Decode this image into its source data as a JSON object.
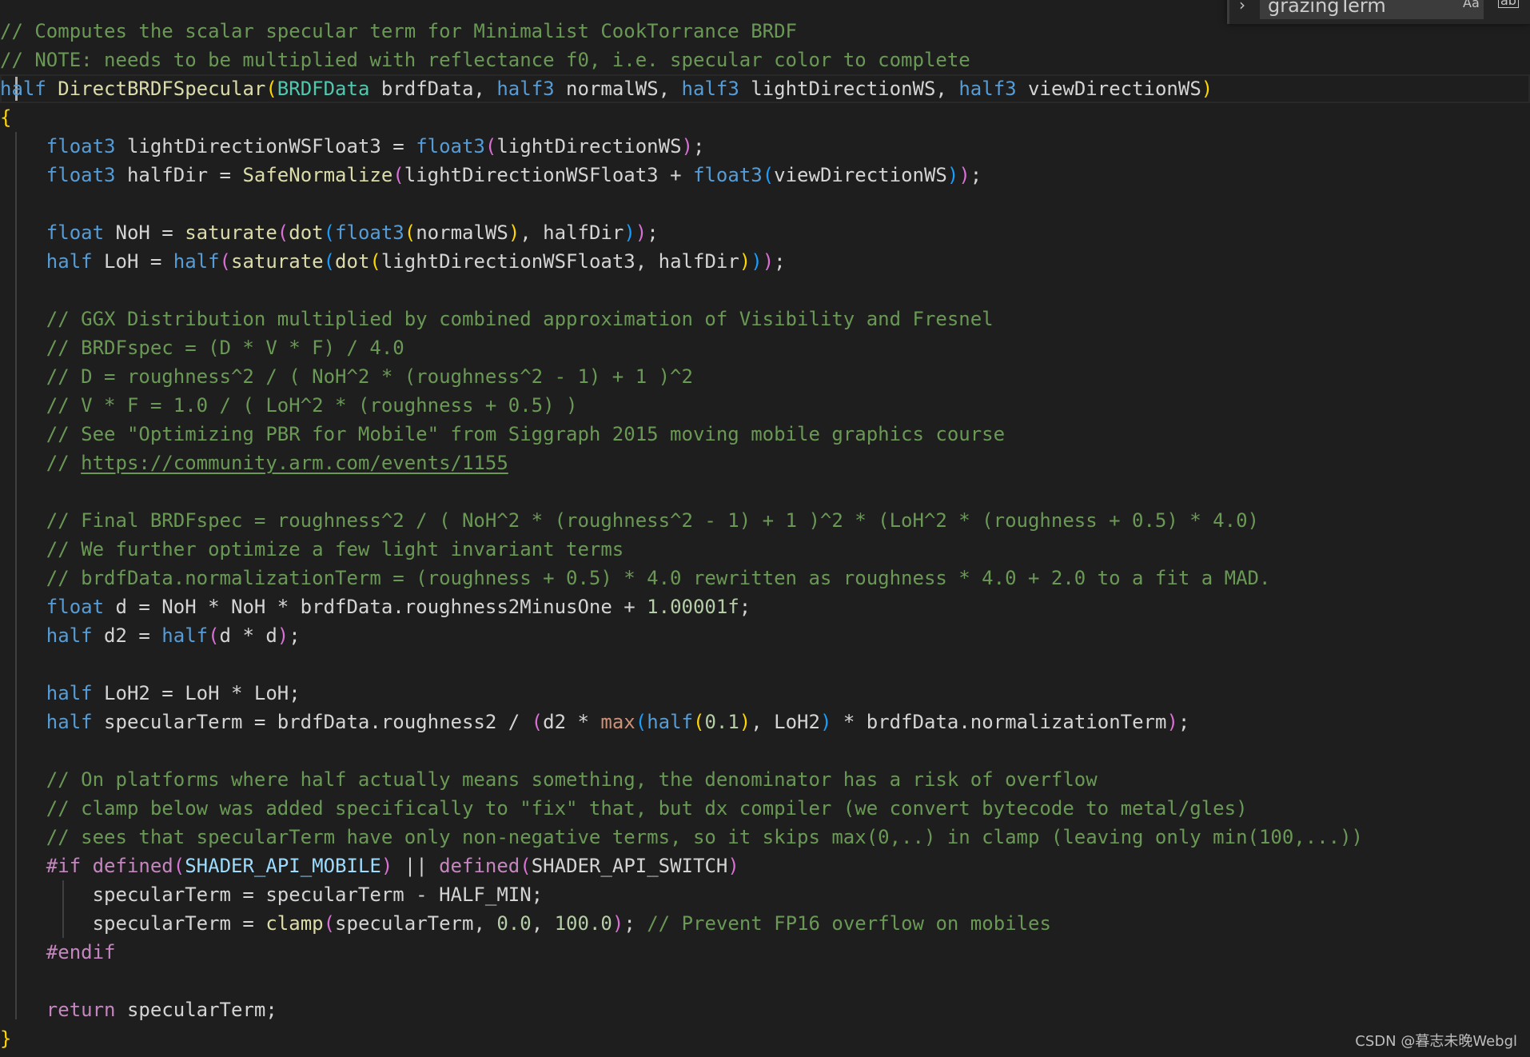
{
  "find_widget": {
    "toggle_icon": "chevron-right-icon",
    "query": "grazingTerm",
    "match_case_label": "Aa",
    "match_word_label": "ab"
  },
  "code": {
    "l01": "// Computes the scalar specular term for Minimalist CookTorrance BRDF",
    "l02": "// NOTE: needs to be multiplied with reflectance f0, i.e. specular color to complete",
    "l03": {
      "t1": "half",
      "t2": "DirectBRDFSpecular",
      "t3": "(",
      "t4": "BRDFData",
      "t5": " brdfData, ",
      "t6": "half3",
      "t7": " normalWS, ",
      "t8": "half3",
      "t9": " lightDirectionWS, ",
      "t10": "half3",
      "t11": " viewDirectionWS",
      "t12": ")"
    },
    "l04": "{",
    "l05": {
      "t1": "float3",
      "t2": " lightDirectionWSFloat3 = ",
      "t3": "float3",
      "t4": "(",
      "t5": "lightDirectionWS",
      "t6": ")",
      "t7": ";"
    },
    "l06": {
      "t1": "float3",
      "t2": " halfDir = ",
      "t3": "SafeNormalize",
      "t4": "(",
      "t5": "lightDirectionWSFloat3 + ",
      "t6": "float3",
      "t7": "(",
      "t8": "viewDirectionWS",
      "t9": ")",
      "t10": ")",
      "t11": ";"
    },
    "l08": {
      "t1": "float",
      "t2": " NoH = ",
      "t3": "saturate",
      "t4": "(",
      "t5": "dot",
      "t6": "(",
      "t7": "float3",
      "t8": "(",
      "t9": "normalWS",
      "t10": ")",
      "t11": ", halfDir",
      "t12": ")",
      "t13": ")",
      "t14": ";"
    },
    "l09": {
      "t1": "half",
      "t2": " LoH = ",
      "t3": "half",
      "t4": "(",
      "t5": "saturate",
      "t6": "(",
      "t7": "dot",
      "t8": "(",
      "t9": "lightDirectionWSFloat3, halfDir",
      "t10": ")",
      "t11": ")",
      "t12": ")",
      "t13": ";"
    },
    "l11": "// GGX Distribution multiplied by combined approximation of Visibility and Fresnel",
    "l12": "// BRDFspec = (D * V * F) / 4.0",
    "l13": "// D = roughness^2 / ( NoH^2 * (roughness^2 - 1) + 1 )^2",
    "l14": "// V * F = 1.0 / ( LoH^2 * (roughness + 0.5) )",
    "l15": "// See \"Optimizing PBR for Mobile\" from Siggraph 2015 moving mobile graphics course",
    "l16": {
      "prefix": "// ",
      "link": "https://community.arm.com/events/1155"
    },
    "l18": "// Final BRDFspec = roughness^2 / ( NoH^2 * (roughness^2 - 1) + 1 )^2 * (LoH^2 * (roughness + 0.5) * 4.0)",
    "l19": "// We further optimize a few light invariant terms",
    "l20": "// brdfData.normalizationTerm = (roughness + 0.5) * 4.0 rewritten as roughness * 4.0 + 2.0 to a fit a MAD.",
    "l21": {
      "t1": "float",
      "t2": " d = NoH * NoH * brdfData.roughness2MinusOne + ",
      "t3": "1.00001f",
      "t4": ";"
    },
    "l22": {
      "t1": "half",
      "t2": " d2 = ",
      "t3": "half",
      "t4": "(",
      "t5": "d * d",
      "t6": ")",
      "t7": ";"
    },
    "l24": {
      "t1": "half",
      "t2": " LoH2 = LoH * LoH;"
    },
    "l25": {
      "t1": "half",
      "t2": " specularTerm = brdfData.roughness2 / ",
      "t3": "(",
      "t4": "d2 * ",
      "t5": "max",
      "t6": "(",
      "t7": "half",
      "t8": "(",
      "t9": "0.1",
      "t10": ")",
      "t11": ", LoH2",
      "t12": ")",
      "t13": " * brdfData.normalizationTerm",
      "t14": ")",
      "t15": ";"
    },
    "l27": "// On platforms where half actually means something, the denominator has a risk of overflow",
    "l28": "// clamp below was added specifically to \"fix\" that, but dx compiler (we convert bytecode to metal/gles)",
    "l29": "// sees that specularTerm have only non-negative terms, so it skips max(0,..) in clamp (leaving only min(100,...))",
    "l30": {
      "t1": "#if",
      "t2": " ",
      "t3": "defined",
      "t4": "(",
      "t5": "SHADER_API_MOBILE",
      "t6": ")",
      "t7": " || ",
      "t8": "defined",
      "t9": "(",
      "t10": "SHADER_API_SWITCH",
      "t11": ")"
    },
    "l31": "specularTerm = specularTerm - HALF_MIN;",
    "l32": {
      "t1": "specularTerm = ",
      "t2": "clamp",
      "t3": "(",
      "t4": "specularTerm, ",
      "t5": "0.0",
      "t6": ", ",
      "t7": "100.0",
      "t8": ")",
      "t9": "; ",
      "t10": "// Prevent FP16 overflow on mobiles"
    },
    "l33": "#endif",
    "l35": {
      "t1": "return",
      "t2": " specularTerm;"
    },
    "l36": "}"
  },
  "watermark": "CSDN @暮志未晚Webgl"
}
